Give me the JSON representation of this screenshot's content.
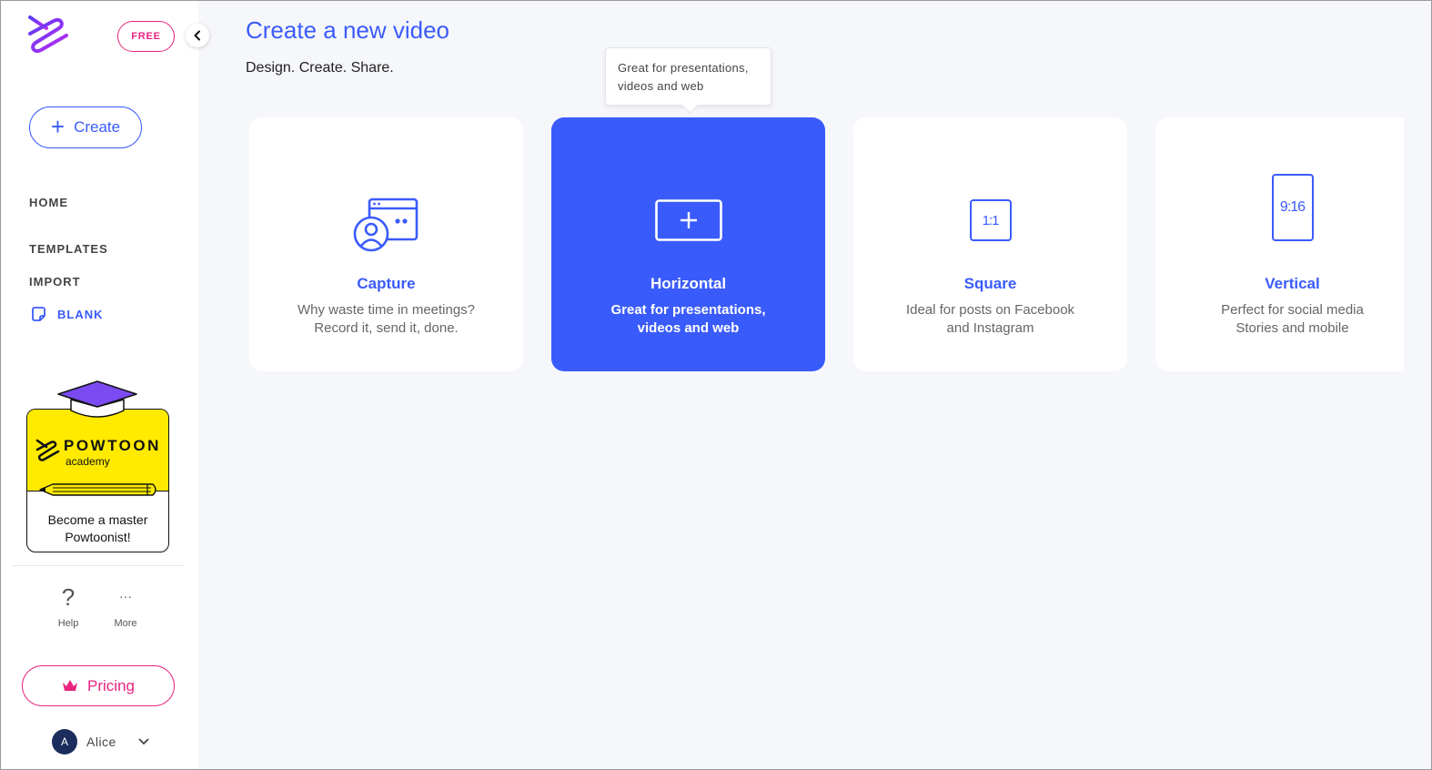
{
  "sidebar": {
    "free_badge": "FREE",
    "create_label": "Create",
    "nav": [
      {
        "label": "HOME"
      },
      {
        "label": "TEMPLATES"
      },
      {
        "label": "IMPORT"
      },
      {
        "label": "BLANK"
      }
    ],
    "academy": {
      "brand": "POWTOON",
      "sub": "academy",
      "text_line1": "Become a master",
      "text_line2": "Powtoonist!"
    },
    "help_label": "Help",
    "help_icon": "?",
    "more_label": "More",
    "more_icon": "···",
    "pricing_label": "Pricing",
    "user": {
      "initial": "A",
      "name": "Alice"
    }
  },
  "main": {
    "title": "Create a new video",
    "subtitle": "Design. Create. Share.",
    "tooltip": "Great for presentations, videos and web",
    "cards": [
      {
        "title": "Capture",
        "desc": "Why waste time in meetings?\nRecord it, send it, done.",
        "icon": "capture-icon"
      },
      {
        "title": "Horizontal",
        "desc": "Great for presentations,\nvideos and web",
        "icon": "horizontal-plus-icon"
      },
      {
        "title": "Square",
        "desc": "Ideal for posts on Facebook\nand Instagram",
        "icon": "square-ratio-icon",
        "ratio": "1:1"
      },
      {
        "title": "Vertical",
        "desc": "Perfect for social media\nStories and mobile",
        "icon": "vertical-ratio-icon",
        "ratio": "9:16"
      }
    ]
  },
  "colors": {
    "accent": "#3a5bfb",
    "pink": "#e8247f",
    "academy_yellow": "#ffea00",
    "background": "#f6f7fb"
  }
}
